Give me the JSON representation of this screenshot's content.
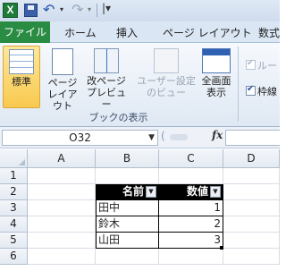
{
  "qat": {
    "logo": "X",
    "undo": "↶",
    "redo": "↷",
    "caret": "▾",
    "customize": "|▾"
  },
  "tabs": {
    "file": "ファイル",
    "home": "ホーム",
    "insert": "挿入",
    "page_layout": "ページ レイアウト",
    "formulas": "数式"
  },
  "ribbon": {
    "normal": "標準",
    "page_layout_line1": "ページ",
    "page_layout_line2": "レイアウト",
    "page_break_line1": "改ページ",
    "page_break_line2": "プレビュー",
    "custom_view_line1": "ユーザー設定",
    "custom_view_line2": "のビュー",
    "full_screen_line1": "全画面",
    "full_screen_line2": "表示",
    "group_label": "ブックの表示",
    "ruler": "ルー",
    "gridlines": "枠線"
  },
  "formula_bar": {
    "name_box": "O32",
    "fx": "fx",
    "formula": ""
  },
  "sheet": {
    "columns": [
      "A",
      "B",
      "C",
      "D"
    ],
    "rows": [
      "1",
      "2",
      "3",
      "4",
      "5",
      "6"
    ],
    "table": {
      "header": [
        "名前",
        "数値"
      ],
      "rows": [
        {
          "name": "田中",
          "value": "1"
        },
        {
          "name": "鈴木",
          "value": "2"
        },
        {
          "name": "山田",
          "value": "3"
        }
      ]
    }
  }
}
